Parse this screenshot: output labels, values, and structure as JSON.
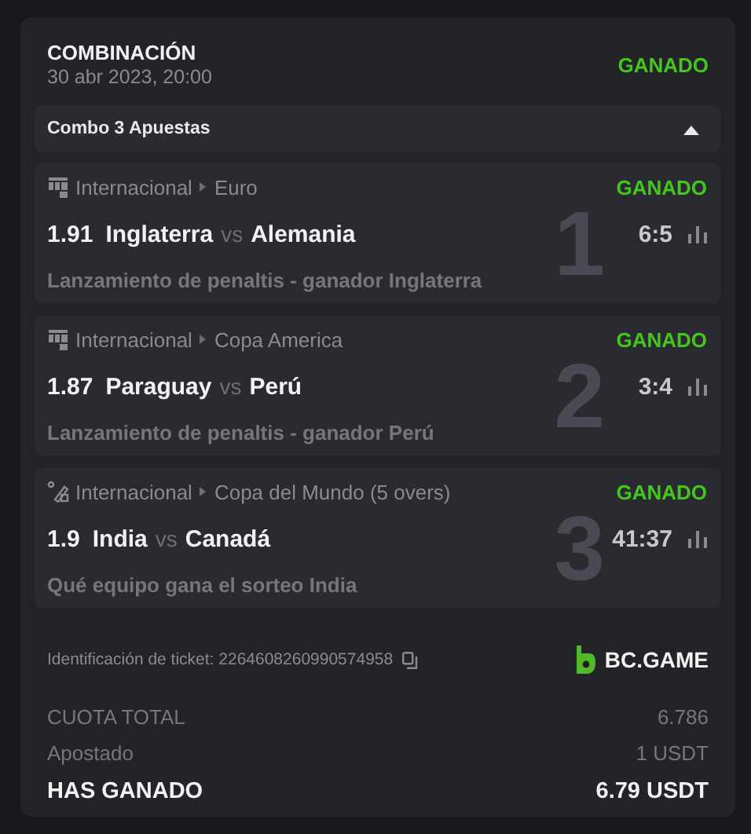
{
  "bet": {
    "type": "COMBINACIÓN",
    "date": "30 abr 2023, 20:00",
    "status": "GANADO"
  },
  "combo": {
    "label": "Combo 3 Apuestas",
    "expanded": true
  },
  "legs": [
    {
      "kind": "football",
      "category": "Internacional",
      "league": "Euro",
      "status": "GANADO",
      "odds": "1.91",
      "home": "Inglaterra",
      "vs": "vs",
      "away": "Alemania",
      "score": "6:5",
      "market": "Lanzamiento de penaltis - ganador Inglaterra",
      "index": "1"
    },
    {
      "kind": "football",
      "category": "Internacional",
      "league": "Copa America",
      "status": "GANADO",
      "odds": "1.87",
      "home": "Paraguay",
      "vs": "vs",
      "away": "Perú",
      "score": "3:4",
      "market": "Lanzamiento de penaltis - ganador Perú",
      "index": "2"
    },
    {
      "kind": "cricket",
      "category": "Internacional",
      "league": "Copa del Mundo (5 overs)",
      "status": "GANADO",
      "odds": "1.9",
      "home": "India",
      "vs": "vs",
      "away": "Canadá",
      "score": "41:37",
      "market": "Qué equipo gana el sorteo India",
      "index": "3"
    }
  ],
  "ticket": {
    "label": "Identificación de ticket: 2264608260990574958"
  },
  "brand": "BC.GAME",
  "totals": [
    {
      "kind": "muted",
      "label": "CUOTA TOTAL",
      "value": "6.786"
    },
    {
      "kind": "muted",
      "label": "Apostado",
      "value": "1 USDT"
    },
    {
      "kind": "strong",
      "label": "HAS GANADO",
      "value": "6.79 USDT"
    }
  ]
}
